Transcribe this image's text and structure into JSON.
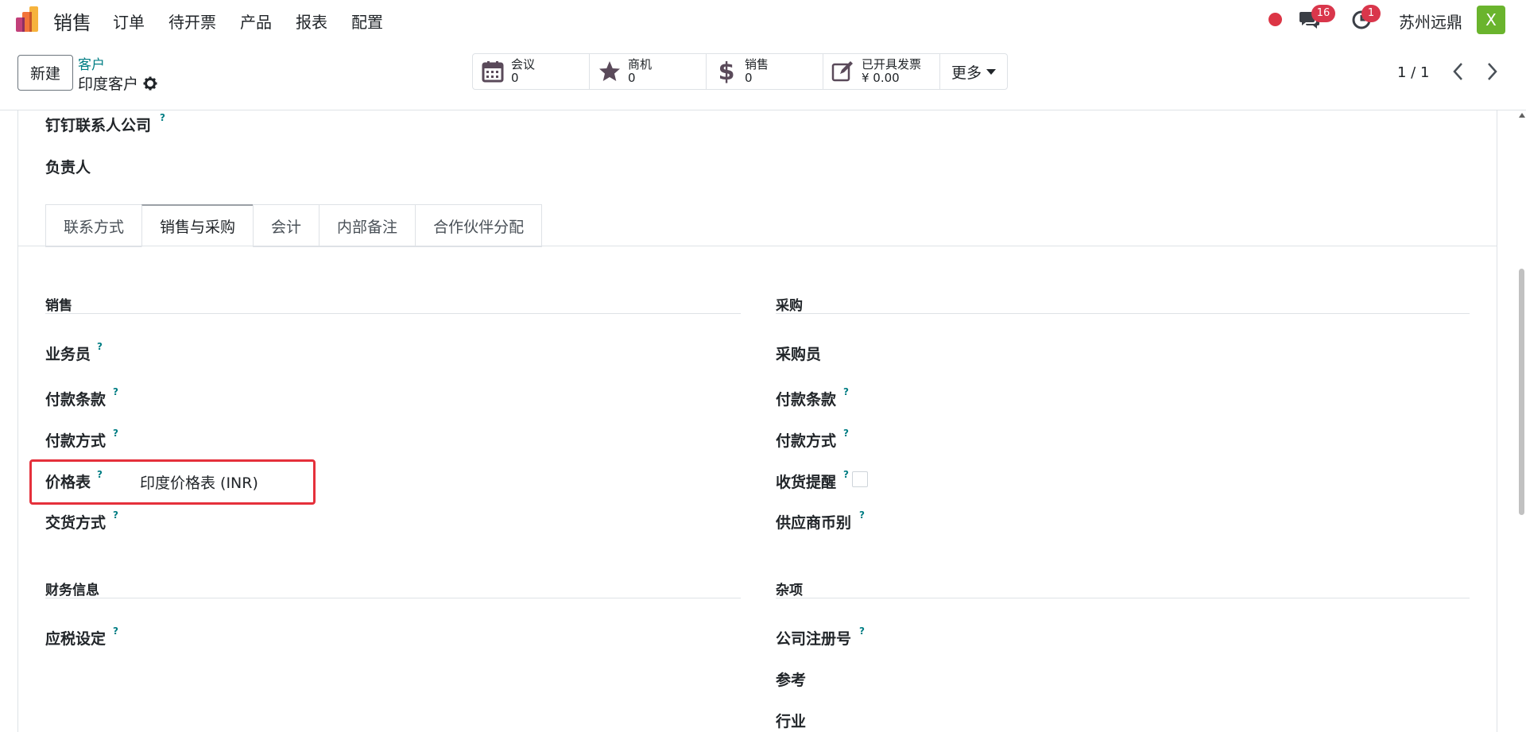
{
  "navbar": {
    "app_name": "销售",
    "menu": [
      "订单",
      "待开票",
      "产品",
      "报表",
      "配置"
    ],
    "chat_count": "16",
    "activity_count": "1",
    "company": "苏州远鼎",
    "avatar_letter": "X",
    "colors": {
      "badge": "#d9364b",
      "avatar": "#6ab42d",
      "record_dot": "#dc3545"
    }
  },
  "control": {
    "new_label": "新建",
    "breadcrumb_parent": "客户",
    "breadcrumb_current": "印度客户",
    "smart_buttons": [
      {
        "icon": "calendar-icon",
        "label": "会议",
        "value": "0"
      },
      {
        "icon": "star-icon",
        "label": "商机",
        "value": "0"
      },
      {
        "icon": "dollar-icon",
        "label": "销售",
        "value": "0"
      },
      {
        "icon": "edit-icon",
        "label": "已开具发票",
        "value": "¥ 0.00"
      }
    ],
    "more_label": "更多",
    "pager": "1 / 1"
  },
  "form": {
    "top_fields": {
      "dingtalk_company": "钉钉联系人公司",
      "owner": "负责人"
    },
    "tabs": [
      "联系方式",
      "销售与采购",
      "会计",
      "内部备注",
      "合作伙伴分配"
    ],
    "active_tab": "销售与采购",
    "sales": {
      "title": "销售",
      "salesperson": "业务员",
      "payment_terms": "付款条款",
      "payment_method": "付款方式",
      "pricelist": "价格表",
      "pricelist_value": "印度价格表 (INR)",
      "delivery_method": "交货方式"
    },
    "purchase": {
      "title": "采购",
      "buyer": "采购员",
      "payment_terms": "付款条款",
      "payment_method": "付款方式",
      "receipt_reminder": "收货提醒",
      "supplier_currency": "供应商币别"
    },
    "fiscal": {
      "title": "财务信息",
      "fiscal_position": "应税设定"
    },
    "misc": {
      "title": "杂项",
      "company_registry": "公司注册号",
      "reference": "参考",
      "industry": "行业"
    },
    "help_mark": "?",
    "colors": {
      "accent": "#017e84",
      "highlight": "#e5303b"
    }
  }
}
